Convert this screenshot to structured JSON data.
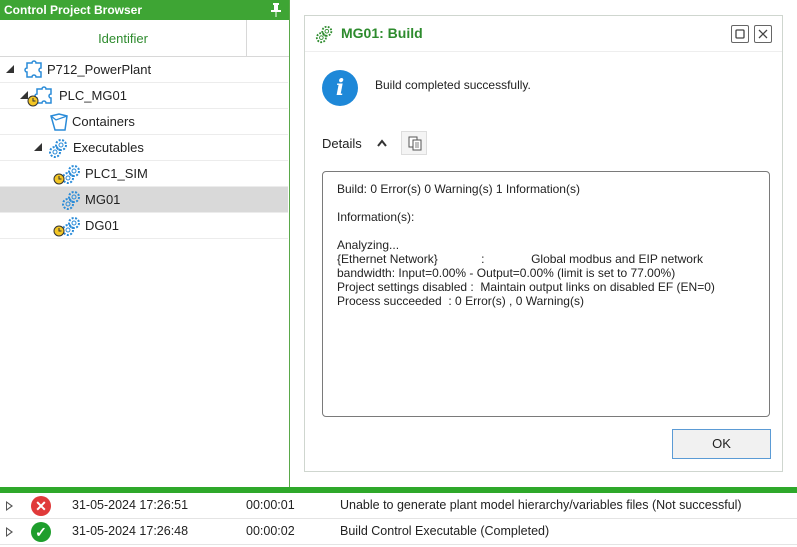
{
  "browser": {
    "title": "Control Project Browser",
    "column_header": "Identifier",
    "items": [
      {
        "label": "P712_PowerPlant",
        "icon": "project-puzzle-icon"
      },
      {
        "label": "PLC_MG01",
        "icon": "plc-puzzle-icon"
      },
      {
        "label": "Containers",
        "icon": "container-icon"
      },
      {
        "label": "Executables",
        "icon": "executables-gear-icon"
      },
      {
        "label": "PLC1_SIM",
        "icon": "executable-gear-icon"
      },
      {
        "label": "MG01",
        "icon": "executable-gear-icon"
      },
      {
        "label": "DG01",
        "icon": "executable-gear-icon"
      }
    ]
  },
  "dialog": {
    "title": "MG01: Build",
    "message": "Build completed successfully.",
    "details_label": "Details",
    "log_text": "Build: 0 Error(s) 0 Warning(s) 1 Information(s)\n\nInformation(s):\n\nAnalyzing...\n{Ethernet Network}             :              Global modbus and EIP network bandwidth: Input=0.00% - Output=0.00% (limit is set to 77.00%)\nProject settings disabled :  Maintain output links on disabled EF (EN=0)\nProcess succeeded  : 0 Error(s) , 0 Warning(s)",
    "ok_label": "OK"
  },
  "log_rows": [
    {
      "status": "error",
      "timestamp": "31-05-2024 17:26:51",
      "duration": "00:00:01",
      "message": "Unable to generate plant model hierarchy/variables files (Not successful)"
    },
    {
      "status": "success",
      "timestamp": "31-05-2024 17:26:48",
      "duration": "00:00:02",
      "message": "Build Control Executable (Completed)"
    }
  ],
  "colors": {
    "accent_green": "#3ea534",
    "error_red": "#e03a3a",
    "success_green": "#1e9e2c",
    "info_blue": "#1e88d8"
  }
}
